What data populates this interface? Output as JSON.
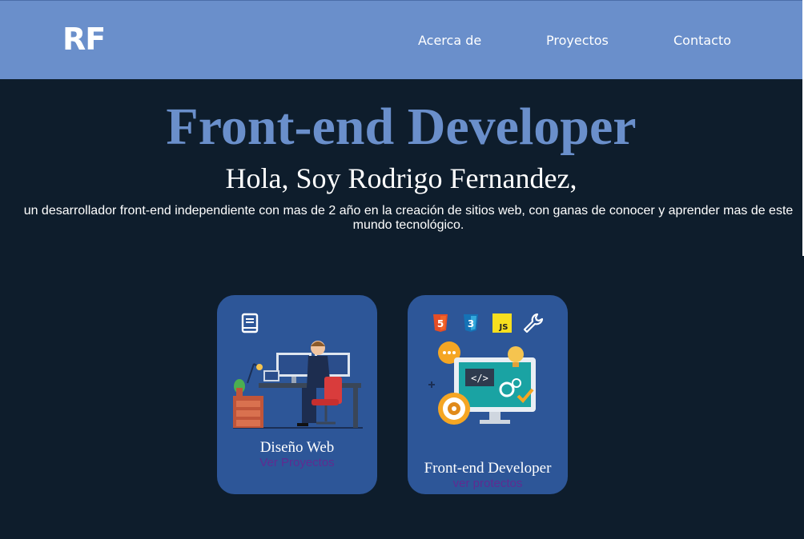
{
  "header": {
    "logo": "RF",
    "nav": [
      "Acerca de",
      "Proyectos",
      "Contacto"
    ]
  },
  "hero": {
    "title": "Front-end Developer",
    "subtitle": "Hola, Soy Rodrigo Fernandez,",
    "description": "un desarrollador front-end independiente con mas de 2 año en la creación de sitios web, con ganas de conocer y aprender mas de este mundo tecnológico."
  },
  "cards": [
    {
      "title": "Diseño Web",
      "link": "Ver Proyectos",
      "icons": [
        "book-icon",
        "developer-at-desk-illustration"
      ]
    },
    {
      "title": "Front-end Developer",
      "link": "ver protectos",
      "icons": [
        "html5-icon",
        "css3-icon",
        "js-icon",
        "wrench-icon",
        "coding-monitor-illustration"
      ]
    }
  ],
  "badges": {
    "html5": "5",
    "css3": "3",
    "js": "JS"
  },
  "colors": {
    "nav_bg": "#6a8fcb",
    "page_bg": "#0e1d2c",
    "card_bg": "#2d5698",
    "title": "#6a8fcb",
    "link": "#5f2c91"
  }
}
